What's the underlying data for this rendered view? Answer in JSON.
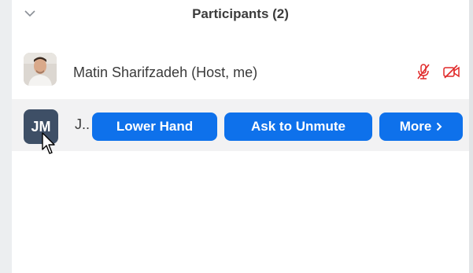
{
  "header": {
    "title": "Participants (2)",
    "collapse_icon": "chevron-down-icon"
  },
  "participants": [
    {
      "name": "Matin Sharifzadeh (Host, me)",
      "avatar": "photo",
      "mic_icon": "muted-microphone-icon",
      "video_icon": "video-off-icon"
    },
    {
      "initials": "JM",
      "name_truncated": "J..",
      "actions": {
        "lower_hand": "Lower Hand",
        "ask_to_unmute": "Ask to Unmute",
        "more": "More"
      }
    }
  ],
  "colors": {
    "accent": "#0e71eb",
    "muted_red": "#e02828",
    "avatar_bg": "#3e4f66"
  }
}
